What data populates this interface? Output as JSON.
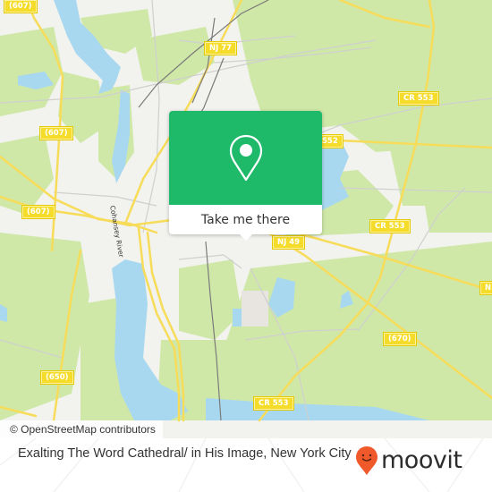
{
  "map": {
    "road_labels": [
      {
        "text": "(607)",
        "name": "road-label-607-top"
      },
      {
        "text": "NJ 77",
        "name": "road-label-nj77"
      },
      {
        "text": "(607)",
        "name": "road-label-607-mid"
      },
      {
        "text": "(607)",
        "name": "road-label-607-lower"
      },
      {
        "text": "CR 553",
        "name": "road-label-cr553-upper"
      },
      {
        "text": "552",
        "name": "road-label-552"
      },
      {
        "text": "CR 553",
        "name": "road-label-cr553-mid"
      },
      {
        "text": "NJ 49",
        "name": "road-label-nj49"
      },
      {
        "text": "N",
        "name": "road-label-nj49-right"
      },
      {
        "text": "(670)",
        "name": "road-label-670"
      },
      {
        "text": "(650)",
        "name": "road-label-650"
      },
      {
        "text": "CR 553",
        "name": "road-label-cr553-lower"
      }
    ],
    "river_label": "Cohansey River",
    "attribution": "© OpenStreetMap contributors",
    "colors": {
      "land": "#f2f2ee",
      "forest": "#cfe8a8",
      "water": "#a8d8f0",
      "road": "#f7dc5a",
      "minor_road": "#cfcfcf",
      "rail": "#7a7a7a"
    }
  },
  "popup": {
    "icon": "map-pin-icon",
    "button_label": "Take me there",
    "color": "#1fb96a"
  },
  "footer": {
    "place_title": "Exalting The Word Cathedral/ in His Image, New York City",
    "brand": "moovit",
    "brand_icon": "moovit-smiley-pin-icon",
    "brand_color": "#f0592a"
  }
}
